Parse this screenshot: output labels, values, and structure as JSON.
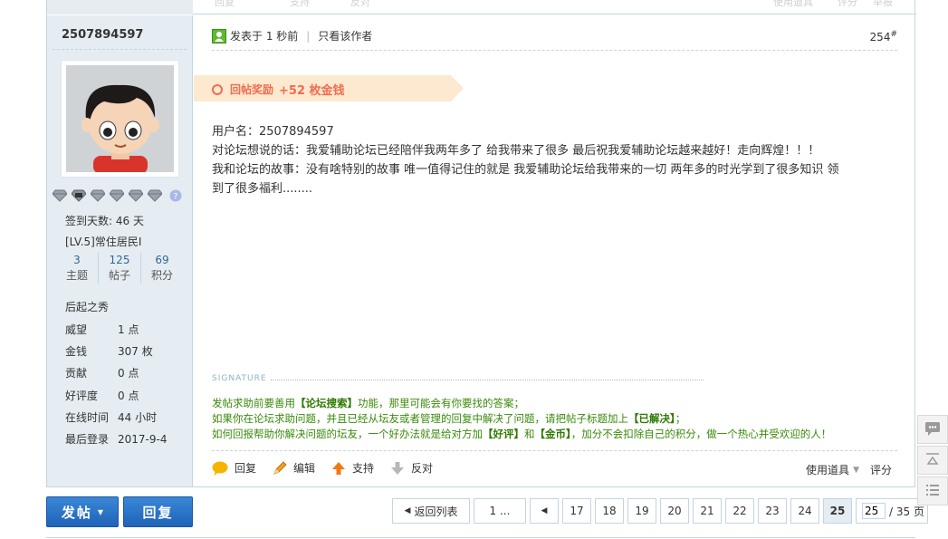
{
  "prev_post_strip": {
    "reply": "回复",
    "support": "支持",
    "oppose": "反对",
    "tools": "使用道具",
    "rate": "评分",
    "report": "举报"
  },
  "author": {
    "name": "2507894597",
    "checkin_days": "签到天数: 46 天",
    "level": "[LV.5]常住居民I",
    "counts": [
      {
        "num": "3",
        "label": "主题"
      },
      {
        "num": "125",
        "label": "帖子"
      },
      {
        "num": "69",
        "label": "积分"
      }
    ],
    "rank_title": "后起之秀",
    "stats": [
      {
        "k": "威望",
        "v": "1 点"
      },
      {
        "k": "金钱",
        "v": "307 枚"
      },
      {
        "k": "贡献",
        "v": "0 点"
      },
      {
        "k": "好评度",
        "v": "0 点"
      },
      {
        "k": "在线时间",
        "v": "44 小时"
      },
      {
        "k": "最后登录",
        "v": "2017-9-4"
      }
    ]
  },
  "post": {
    "posted": "发表于 1 秒前",
    "only_author": "只看该作者",
    "floor": "254",
    "floor_mark": "#",
    "reward_label": "回帖奖励",
    "reward_amount": "+52 枚金钱",
    "lines": [
      "用户名：2507894597",
      "对论坛想说的话：我爱辅助论坛已经陪伴我两年多了  给我带来了很多 最后祝我爱辅助论坛越来越好！走向辉煌！！！",
      "我和论坛的故事：没有啥特别的故事 唯一值得记住的就是 我爱辅助论坛给我带来的一切 两年多的时光学到了很多知识 领",
      "到了很多福利........"
    ],
    "signature_label": "SIGNATURE",
    "signature": {
      "l1a": "发帖求助前要善用",
      "l1b": "【论坛搜索】",
      "l1c": "功能，那里可能会有你要找的答案；",
      "l2a": "如果你在论坛求助问题，并且已经从坛友或者管理的回复中解决了问题，请把帖子标题加上",
      "l2b": "【已解决】",
      "l2c": "；",
      "l3a": "如何回报帮助你解决问题的坛友，一个好办法就是给对方加",
      "l3b": "【好评】",
      "l3c": "和",
      "l3d": "【金币】",
      "l3e": "，加分不会扣除自己的积分，做一个热心并受欢迎的人！"
    },
    "actions": {
      "reply": "回复",
      "edit": "编辑",
      "support": "支持",
      "oppose": "反对",
      "tools": "使用道具",
      "rate": "评分"
    }
  },
  "footer": {
    "post_button": "发帖",
    "reply_button": "回复",
    "pager": {
      "back": "返回列表",
      "first": "1 ...",
      "pages": [
        "17",
        "18",
        "19",
        "20",
        "21",
        "22",
        "23",
        "24"
      ],
      "current": "25",
      "jump_value": "25",
      "total": "/ 35 页"
    }
  },
  "colors": {
    "accent_blue": "#2a74c6",
    "sidebar_bg": "#e5edf2",
    "reward_orange": "#f26c4f",
    "signature_green": "#3a8a0a"
  }
}
